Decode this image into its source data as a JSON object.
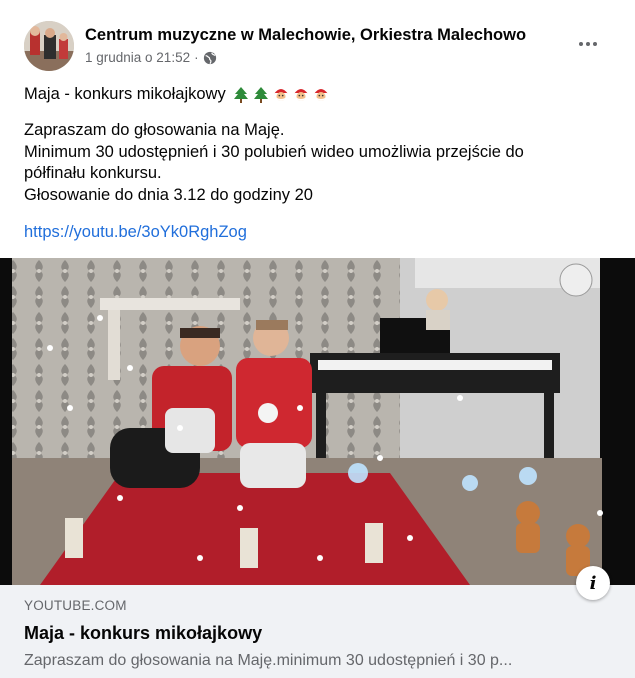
{
  "post": {
    "page_name": "Centrum muzyczne w Malechowie, Orkiestra Malechowo",
    "date": "1 grudnia o 21:52",
    "separator": "·",
    "privacy_icon": "globe-icon",
    "more_icon": "more-options-icon",
    "title": "Maja - konkurs mikołajkowy",
    "title_emojis": [
      "christmas-tree-icon",
      "christmas-tree-icon",
      "santa-face-icon",
      "santa-face-icon",
      "santa-face-icon"
    ],
    "body_lines": [
      "Zapraszam do głosowania na Maję.",
      "Minimum 30 udostępnień i 30 polubień wideo umożliwia przejście do",
      "półfinału konkursu.",
      "Głosowanie do dnia 3.12 do godziny 20"
    ],
    "link": "https://youtu.be/3oYk0RghZog"
  },
  "link_preview": {
    "domain": "YOUTUBE.COM",
    "title": "Maja - konkurs mikołajkowy",
    "description": "Zapraszam do głosowania na Maję.minimum 30 udostępnień i 30 p...",
    "info_label": "i"
  },
  "colors": {
    "link": "#216fdb",
    "secondary_text": "#65676b",
    "footer_bg": "#f0f2f5"
  }
}
